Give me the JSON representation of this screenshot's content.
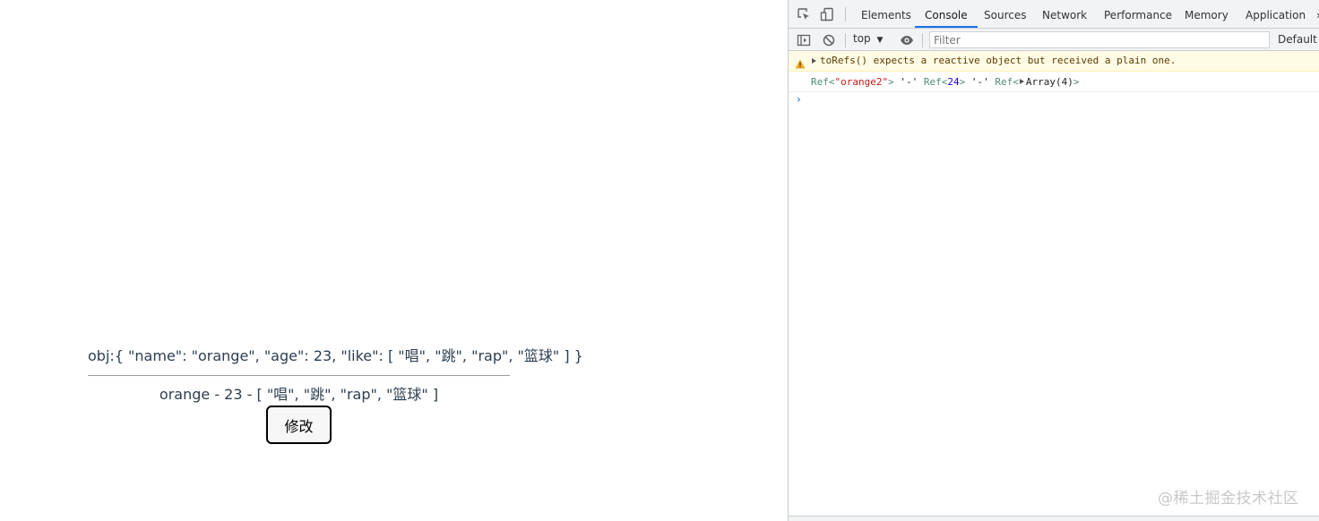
{
  "page": {
    "obj_text": "obj:{ \"name\": \"orange\", \"age\": 23, \"like\": [ \"唱\", \"跳\", \"rap\", \"篮球\" ] }",
    "refs_text": "orange - 23 - [ \"唱\", \"跳\", \"rap\", \"篮球\" ]",
    "edit_button_label": "修改"
  },
  "devtools": {
    "tabs": [
      "Elements",
      "Console",
      "Sources",
      "Network",
      "Performance",
      "Memory",
      "Application"
    ],
    "active_tab": "Console",
    "tabs_overflow_glyph": "»",
    "context_select": "top",
    "context_select_arrow": "▼",
    "filter_placeholder": "Filter",
    "levels_label": "Default levels",
    "warning": {
      "text": "toRefs() expects a reactive object but received a plain one."
    },
    "log": {
      "ref1_prefix": "Ref<",
      "ref1_value": "\"orange2\"",
      "ref1_suffix": ">",
      "sep1": "'-'",
      "ref2_prefix": "Ref<",
      "ref2_value": "24",
      "ref2_suffix": ">",
      "sep2": "'-'",
      "ref3_prefix": "Ref<",
      "ref3_value": "Array(4)",
      "ref3_suffix": ">"
    },
    "prompt": "›",
    "colors": {
      "accent": "#1a73e8",
      "warning_bg": "#fffbe5",
      "warning_icon": "#f2ab26",
      "string": "#c41a16",
      "number": "#1c00cf",
      "ref": "#4e8b7b"
    }
  },
  "watermark": "@稀土掘金技术社区",
  "icons": {
    "inspect": "inspect-element-icon",
    "device": "device-toolbar-icon",
    "sidebar": "show-sidebar-icon",
    "clear": "clear-console-icon",
    "eye": "live-expression-eye-icon",
    "warning": "warning-triangle-icon"
  }
}
